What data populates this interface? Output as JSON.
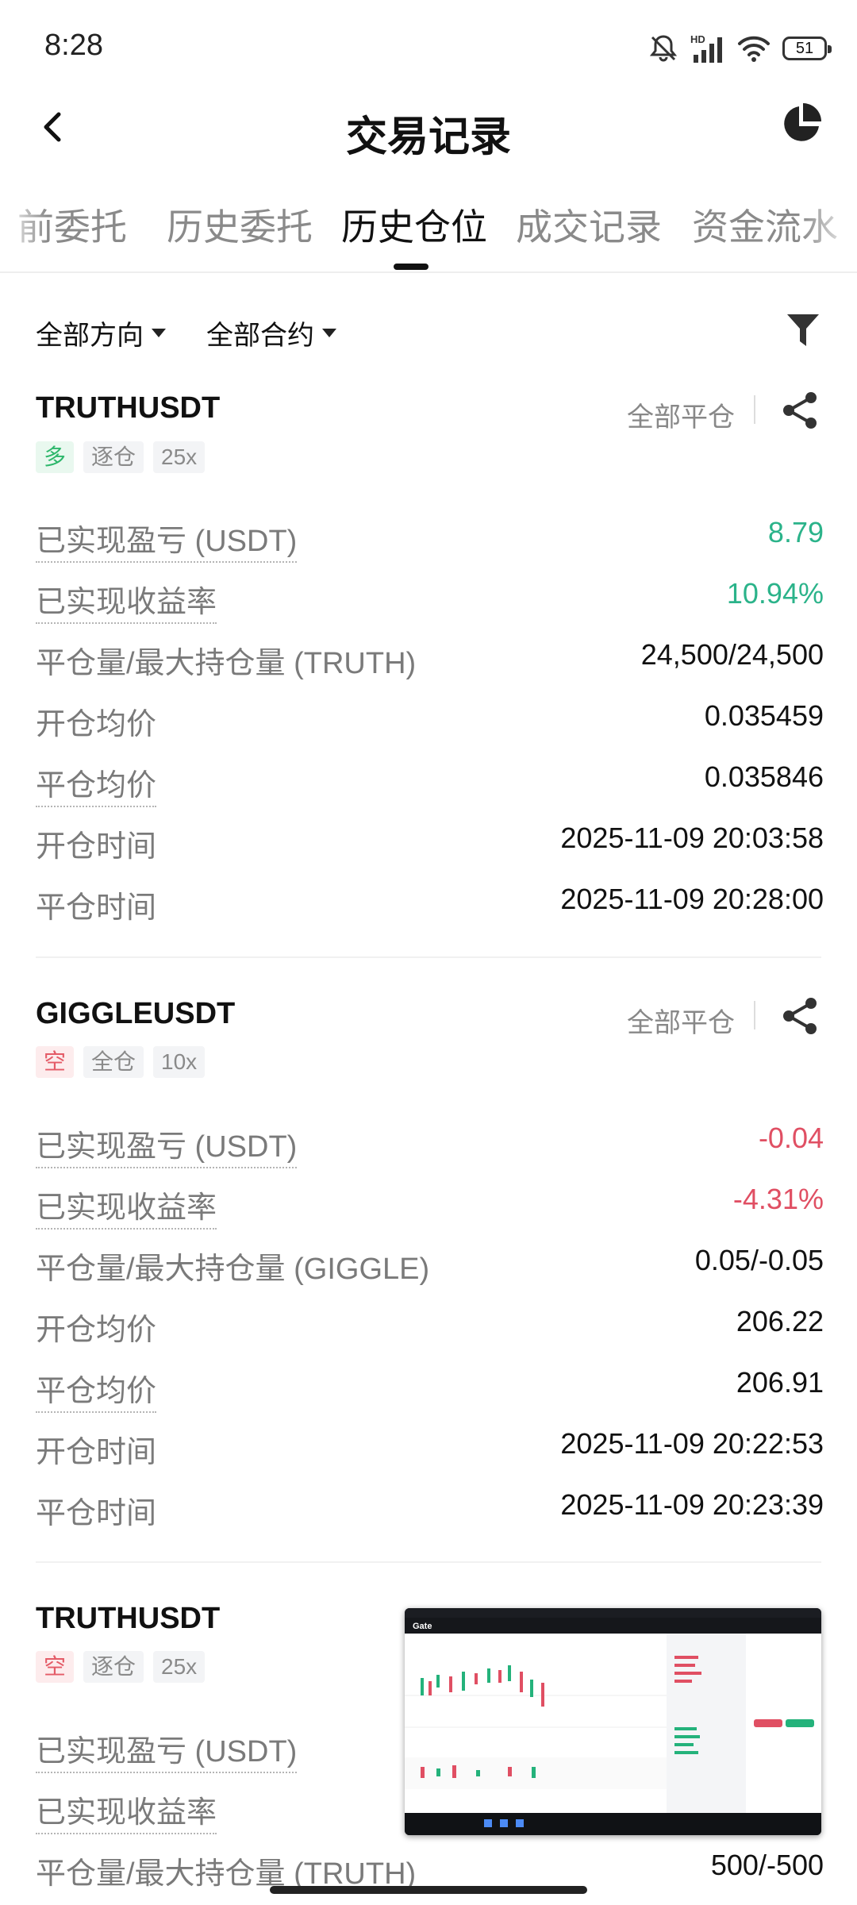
{
  "status_bar": {
    "time": "8:28",
    "network": "HD",
    "battery": "51"
  },
  "header": {
    "title": "交易记录",
    "back_icon": "chevron-left-icon",
    "right_icon": "pie-chart-icon"
  },
  "tabs": [
    {
      "label": "前委托"
    },
    {
      "label": "历史委托"
    },
    {
      "label": "历史仓位"
    },
    {
      "label": "成交记录"
    },
    {
      "label": "资金流水"
    }
  ],
  "active_tab": "历史仓位",
  "filters": {
    "direction": "全部方向",
    "contract": "全部合约"
  },
  "positions": [
    {
      "symbol": "TRUTHUSDT",
      "close_all": "全部平仓",
      "side": "多",
      "margin_mode": "逐仓",
      "leverage": "25x",
      "rows": [
        {
          "label": "已实现盈亏 (USDT)",
          "value": "8.79"
        },
        {
          "label": "已实现收益率",
          "value": "10.94%"
        },
        {
          "label": "平仓量/最大持仓量 (TRUTH)",
          "value": "24,500/24,500"
        },
        {
          "label": "开仓均价",
          "value": "0.035459"
        },
        {
          "label": "平仓均价",
          "value": "0.035846"
        },
        {
          "label": "开仓时间",
          "value": "2025-11-09 20:03:58"
        },
        {
          "label": "平仓时间",
          "value": "2025-11-09 20:28:00"
        }
      ]
    },
    {
      "symbol": "GIGGLEUSDT",
      "close_all": "全部平仓",
      "side": "空",
      "margin_mode": "全仓",
      "leverage": "10x",
      "rows": [
        {
          "label": "已实现盈亏 (USDT)",
          "value": "-0.04"
        },
        {
          "label": "已实现收益率",
          "value": "-4.31%"
        },
        {
          "label": "平仓量/最大持仓量 (GIGGLE)",
          "value": "0.05/-0.05"
        },
        {
          "label": "开仓均价",
          "value": "206.22"
        },
        {
          "label": "平仓均价",
          "value": "206.91"
        },
        {
          "label": "开仓时间",
          "value": "2025-11-09 20:22:53"
        },
        {
          "label": "平仓时间",
          "value": "2025-11-09 20:23:39"
        }
      ]
    },
    {
      "symbol": "TRUTHUSDT",
      "side": "空",
      "margin_mode": "逐仓",
      "leverage": "25x",
      "rows": [
        {
          "label": "已实现盈亏 (USDT)"
        },
        {
          "label": "已实现收益率"
        },
        {
          "label": "平仓量/最大持仓量 (TRUTH)",
          "value": "500/-500"
        }
      ]
    }
  ],
  "colors": {
    "profit": "#2bb38a",
    "loss": "#e04f63",
    "long_tag": "#2db76b",
    "short_tag": "#e45b67"
  },
  "thumbnail": {
    "logo_text": "Gate"
  }
}
